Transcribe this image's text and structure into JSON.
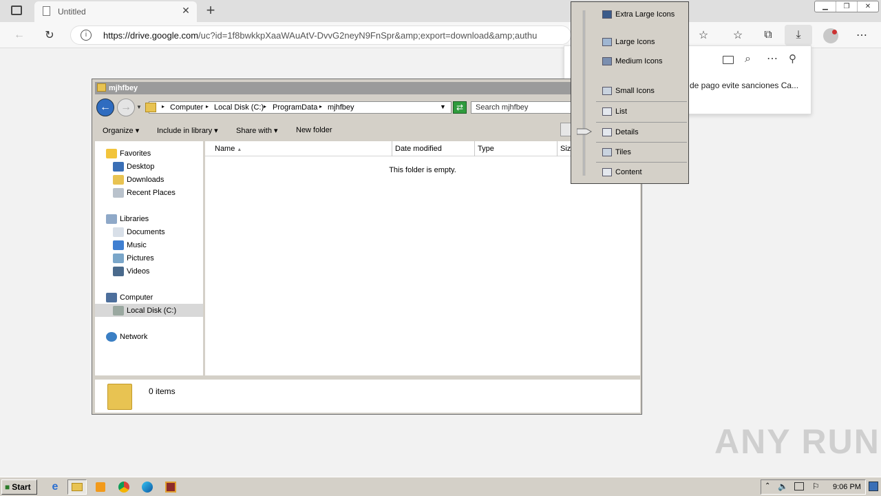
{
  "browser": {
    "tab_title": "Untitled",
    "url_prefix": "https://drive.google.com",
    "url_rest": "/uc?id=1f8bwkkpXaaWAuAtV-DvvG2neyN9FnSpr&amp;export=download&amp;authu",
    "download_panel_text": "de pago evite sanciones Ca..."
  },
  "explorer": {
    "title": "mjhfbey",
    "breadcrumb": [
      "Computer",
      "Local Disk (C:)",
      "ProgramData",
      "mjhfbey"
    ],
    "search_placeholder": "Search mjhfbey",
    "commands": [
      "Organize",
      "Include in library",
      "Share with",
      "New folder"
    ],
    "nav": {
      "favorites": "Favorites",
      "desktop": "Desktop",
      "downloads": "Downloads",
      "recent": "Recent Places",
      "libraries": "Libraries",
      "documents": "Documents",
      "music": "Music",
      "pictures": "Pictures",
      "videos": "Videos",
      "computer": "Computer",
      "local_disk": "Local Disk (C:)",
      "network": "Network"
    },
    "columns": [
      "Name",
      "Date modified",
      "Type",
      "Size"
    ],
    "empty_message": "This folder is empty.",
    "status_items": "0 items"
  },
  "view_menu": {
    "items": [
      "Extra Large Icons",
      "Large Icons",
      "Medium Icons",
      "Small Icons",
      "List",
      "Details",
      "Tiles",
      "Content"
    ],
    "selected": "Details"
  },
  "taskbar": {
    "start_label": "Start",
    "clock": "9:06 PM"
  },
  "watermark": "ANY RUN"
}
